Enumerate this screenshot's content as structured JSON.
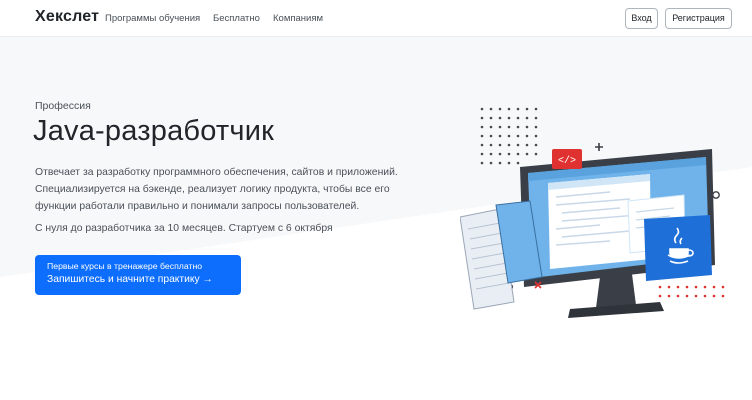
{
  "header": {
    "logo": "Хекслет",
    "nav": [
      "Программы обучения",
      "Бесплатно",
      "Компаниям"
    ],
    "login_label": "Вход",
    "register_label": "Регистрация"
  },
  "hero": {
    "eyebrow": "Профессия",
    "title": "Java-разработчик",
    "description_lines": [
      "Отвечает за разработку программного обеспечения, сайтов и приложений.",
      "Специализируется на бэкенде, реализует логику продукта, чтобы все его",
      "функции работали правильно и понимали запросы пользователей."
    ],
    "schedule": "С нуля до разработчика за 10 месяцев. Стартуем с 6 октября",
    "cta": {
      "top": "Первые курсы в тренажере бесплатно",
      "main": "Запишитесь и начните практику →"
    },
    "illustration": {
      "code_badge": "</>"
    }
  },
  "colors": {
    "primary": "#0d6efd",
    "hero_bg": "#f7f8fa",
    "accent_red": "#e03131"
  }
}
